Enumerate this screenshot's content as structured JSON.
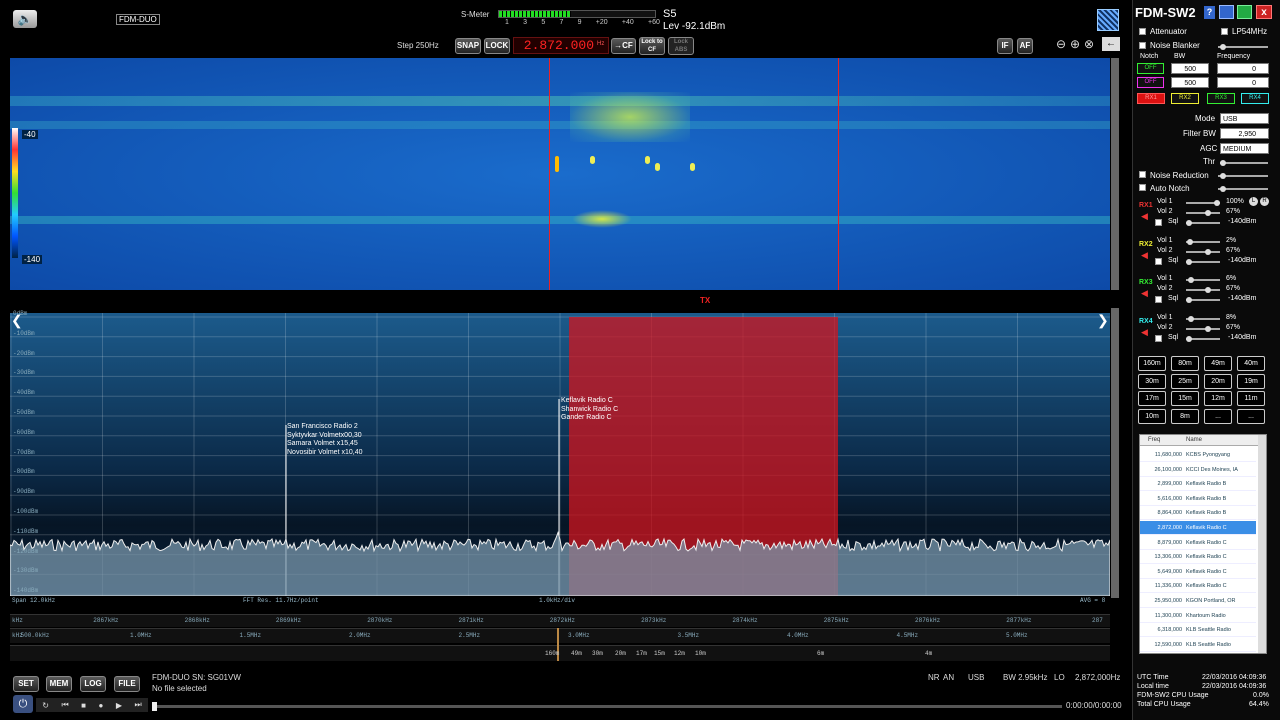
{
  "topbar": {
    "device": "FDM-DUO",
    "smeter_label": "S-Meter",
    "smeter_value": "S5",
    "level": "Lev -92.1dBm",
    "meter_ticks": [
      "1",
      "3",
      "5",
      "7",
      "9",
      "+20",
      "+40",
      "+60"
    ],
    "step": "Step 250Hz",
    "snap": "SNAP",
    "lock": "LOCK",
    "freq": "2.872.000",
    "freq_unit": "Hz",
    "cf": "→CF",
    "lock_to_cf": "Lock to CF",
    "lock_abs": "Lock ABS",
    "if": "IF",
    "af": "AF"
  },
  "waterfall": {
    "scale_top": "-40",
    "scale_bottom": "-140",
    "tx": "TX"
  },
  "spectrum": {
    "db_labels": [
      "0dBm",
      "-10dBm",
      "-20dBm",
      "-30dBm",
      "-40dBm",
      "-50dBm",
      "-60dBm",
      "-70dBm",
      "-80dBm",
      "-90dBm",
      "-100dBm",
      "-110dBm",
      "-120dBm",
      "-130dBm",
      "-140dBm"
    ],
    "stations_left": [
      "San Francisco Radio 2",
      "Syktyvkar Volmetx00,30",
      "Samara Volmet x15,45",
      "Novosibir Volmet x10,40"
    ],
    "stations_right": [
      "Keflavik Radio C",
      "Shanwick Radio C",
      "Gander Radio C"
    ],
    "span": "Span 12.0kHz",
    "fft": "FFT Res. 11.7Hz/point",
    "div": "1.0kHz/div",
    "avg": "AVG = 8"
  },
  "freq_axis": {
    "khz": [
      "kHz",
      "2867kHz",
      "2868kHz",
      "2869kHz",
      "2870kHz",
      "2871kHz",
      "2872kHz",
      "2873kHz",
      "2874kHz",
      "2875kHz",
      "2876kHz",
      "2877kHz",
      "287"
    ],
    "mhz": [
      "kHz",
      "500.0kHz",
      "1.0MHz",
      "1.5MHz",
      "2.0MHz",
      "2.5MHz",
      "3.0MHz",
      "3.5MHz",
      "4.0MHz",
      "4.5MHz",
      "5.0MHz"
    ],
    "bands": [
      "160m",
      "49m",
      "30m",
      "20m",
      "17m",
      "15m",
      "12m",
      "10m",
      "6m",
      "4m"
    ]
  },
  "bottom": {
    "set": "SET",
    "mem": "MEM",
    "log": "LOG",
    "file": "FILE",
    "sn": "FDM-DUO SN: SG01VW",
    "file_status": "No file selected",
    "nr": "NR",
    "an": "AN",
    "mode": "USB",
    "bw": "BW 2.95kHz",
    "lo": "LO",
    "lo_freq": "2,872,000Hz",
    "time": "0:00:00/0:00:00"
  },
  "panel": {
    "title": "FDM-SW2",
    "attenuator": "Attenuator",
    "lp54": "LP54MHz",
    "noise_blanker": "Noise Blanker",
    "notch": "Notch",
    "bw": "BW",
    "frequency": "Frequency",
    "notch_off1": "OFF",
    "notch_off2": "OFF",
    "bw1": "500",
    "bw2": "500",
    "f1": "0",
    "f2": "0",
    "rx1": "RX1",
    "rx2": "RX2",
    "rx3": "RX3",
    "rx4": "RX4",
    "mode_lbl": "Mode",
    "mode": "USB",
    "filterbw_lbl": "Filter BW",
    "filterbw": "2,950",
    "agc_lbl": "AGC",
    "agc": "MEDIUM",
    "thr": "Thr",
    "noise_reduction": "Noise Reduction",
    "auto_notch": "Auto Notch",
    "rxs": [
      {
        "label": "RX1",
        "vol1": "Vol 1",
        "vol1v": "100%",
        "vol2": "Vol 2",
        "vol2v": "67%",
        "sql": "Sql",
        "sqlv": "-140dBm",
        "color": "#e33"
      },
      {
        "label": "RX2",
        "vol1": "Vol 1",
        "vol1v": "2%",
        "vol2": "Vol 2",
        "vol2v": "67%",
        "sql": "Sql",
        "sqlv": "-140dBm",
        "color": "#ee3"
      },
      {
        "label": "RX3",
        "vol1": "Vol 1",
        "vol1v": "6%",
        "vol2": "Vol 2",
        "vol2v": "67%",
        "sql": "Sql",
        "sqlv": "-140dBm",
        "color": "#3e3"
      },
      {
        "label": "RX4",
        "vol1": "Vol 1",
        "vol1v": "8%",
        "vol2": "Vol 2",
        "vol2v": "67%",
        "sql": "Sql",
        "sqlv": "-140dBm",
        "color": "#3ee"
      }
    ],
    "l": "L",
    "r": "R",
    "bands": [
      "160m",
      "80m",
      "49m",
      "40m",
      "30m",
      "25m",
      "20m",
      "19m",
      "17m",
      "15m",
      "12m",
      "11m",
      "10m",
      "8m",
      "...",
      "..."
    ],
    "mem_headers": [
      "Freq",
      "Name"
    ],
    "memories": [
      [
        "11,680,000",
        "KCBS Pyongyang"
      ],
      [
        "26,100,000",
        "KCCI Des Moines, IA"
      ],
      [
        "2,899,000",
        "Keflavik Radio B"
      ],
      [
        "5,616,000",
        "Keflavik Radio B"
      ],
      [
        "8,864,000",
        "Keflavik Radio B"
      ],
      [
        "2,872,000",
        "Keflavik Radio C"
      ],
      [
        "8,879,000",
        "Keflavik Radio C"
      ],
      [
        "13,306,000",
        "Keflavik Radio C"
      ],
      [
        "5,649,000",
        "Keflavik Radio C"
      ],
      [
        "11,336,000",
        "Keflavik Radio C"
      ],
      [
        "25,950,000",
        "KGON Portland, OR"
      ],
      [
        "11,300,000",
        "Khartoum Radio"
      ],
      [
        "6,318,000",
        "KLB Seattle Radio"
      ],
      [
        "12,590,000",
        "KLB Seattle Radio"
      ]
    ],
    "utc_lbl": "UTC Time",
    "utc": "22/03/2016 04:09:36",
    "local_lbl": "Local time",
    "local": "22/03/2016 04:09:36",
    "cpu_lbl": "FDM-SW2 CPU Usage",
    "cpu": "0.0%",
    "total_lbl": "Total CPU Usage",
    "total": "64.4%"
  },
  "spectrum_trace": {
    "baseline_dbm": -122,
    "noise_dbm": 4
  }
}
